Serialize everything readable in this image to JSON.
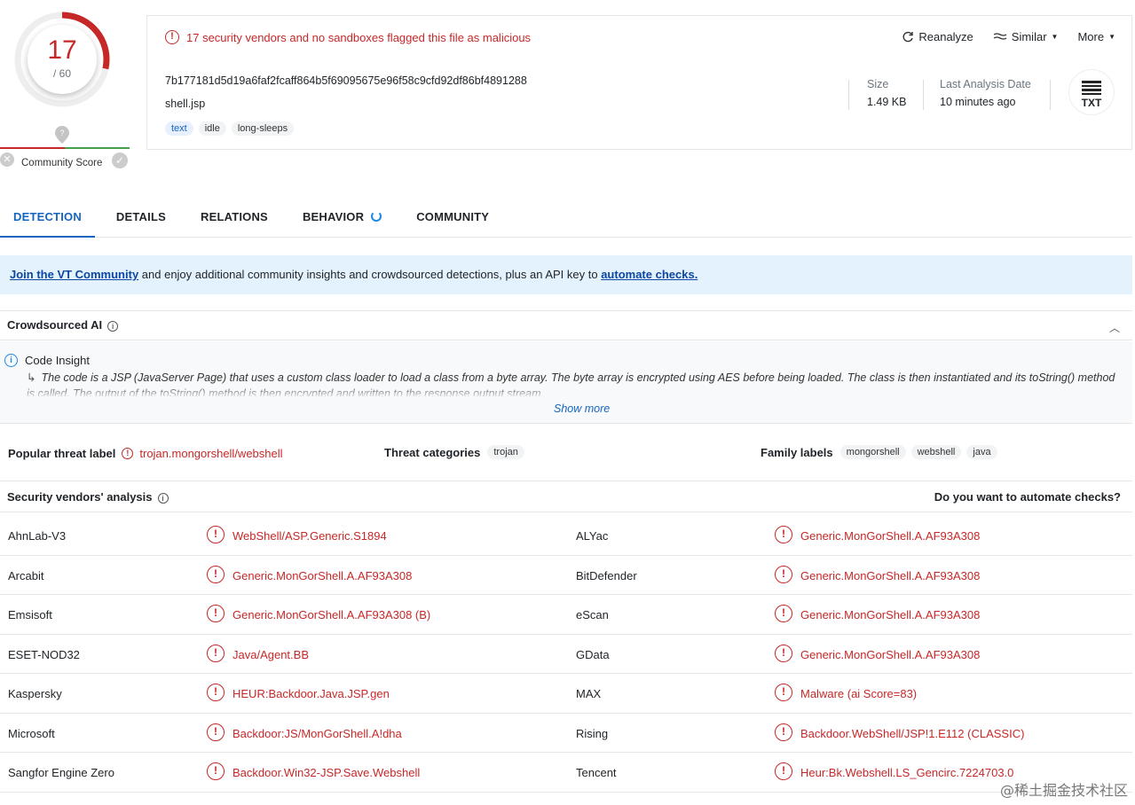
{
  "score": {
    "detections": "17",
    "total": "/ 60",
    "fraction": 0.2833,
    "community_label": "Community Score"
  },
  "alert": {
    "text": "17 security vendors and no sandboxes flagged this file as malicious"
  },
  "actions": {
    "reanalyze": "Reanalyze",
    "similar": "Similar",
    "more": "More"
  },
  "file": {
    "hash": "7b177181d5d19a6faf2fcaff864b5f69095675e96f58c9cfd92df86bf4891288",
    "name": "shell.jsp",
    "tags": [
      "text",
      "idle",
      "long-sleeps"
    ],
    "size_label": "Size",
    "size": "1.49 KB",
    "date_label": "Last Analysis Date",
    "date": "10 minutes ago",
    "type_badge": "TXT"
  },
  "tabs": [
    "DETECTION",
    "DETAILS",
    "RELATIONS",
    "BEHAVIOR",
    "COMMUNITY"
  ],
  "banner": {
    "link1": "Join the VT Community",
    "middle": " and enjoy additional community insights and crowdsourced detections, plus an API key to ",
    "link2": "automate checks."
  },
  "ai": {
    "header": "Crowdsourced AI",
    "title": "Code Insight",
    "arrow": "↳",
    "text": "The code is a JSP (JavaServer Page) that uses a custom class loader to load a class from a byte array. The byte array is encrypted using AES before being loaded. The class is then instantiated and its toString() method is called. The output of the toString() method is then encrypted and written to the response output stream.",
    "show_more": "Show more"
  },
  "labels": {
    "popular_label": "Popular threat label",
    "popular_value": "trojan.mongorshell/webshell",
    "categories_label": "Threat categories",
    "categories": [
      "trojan"
    ],
    "family_label": "Family labels",
    "families": [
      "mongorshell",
      "webshell",
      "java"
    ]
  },
  "vendors": {
    "title": "Security vendors' analysis",
    "automate": "Do you want to automate checks?",
    "rows": [
      {
        "left_name": "AhnLab-V3",
        "left_result": "WebShell/ASP.Generic.S1894",
        "right_name": "ALYac",
        "right_result": "Generic.MonGorShell.A.AF93A308"
      },
      {
        "left_name": "Arcabit",
        "left_result": "Generic.MonGorShell.A.AF93A308",
        "right_name": "BitDefender",
        "right_result": "Generic.MonGorShell.A.AF93A308"
      },
      {
        "left_name": "Emsisoft",
        "left_result": "Generic.MonGorShell.A.AF93A308 (B)",
        "right_name": "eScan",
        "right_result": "Generic.MonGorShell.A.AF93A308"
      },
      {
        "left_name": "ESET-NOD32",
        "left_result": "Java/Agent.BB",
        "right_name": "GData",
        "right_result": "Generic.MonGorShell.A.AF93A308"
      },
      {
        "left_name": "Kaspersky",
        "left_result": "HEUR:Backdoor.Java.JSP.gen",
        "right_name": "MAX",
        "right_result": "Malware (ai Score=83)"
      },
      {
        "left_name": "Microsoft",
        "left_result": "Backdoor:JS/MonGorShell.A!dha",
        "right_name": "Rising",
        "right_result": "Backdoor.WebShell/JSP!1.E112 (CLASSIC)"
      },
      {
        "left_name": "Sangfor Engine Zero",
        "left_result": "Backdoor.Win32-JSP.Save.Webshell",
        "right_name": "Tencent",
        "right_result": "Heur:Bk.Webshell.LS_Gencirc.7224703.0"
      }
    ]
  },
  "watermark": "@稀土掘金技术社区",
  "colors": {
    "malicious": "#c62828",
    "accent": "#1565c0",
    "banner_bg": "#e3f2fd"
  }
}
